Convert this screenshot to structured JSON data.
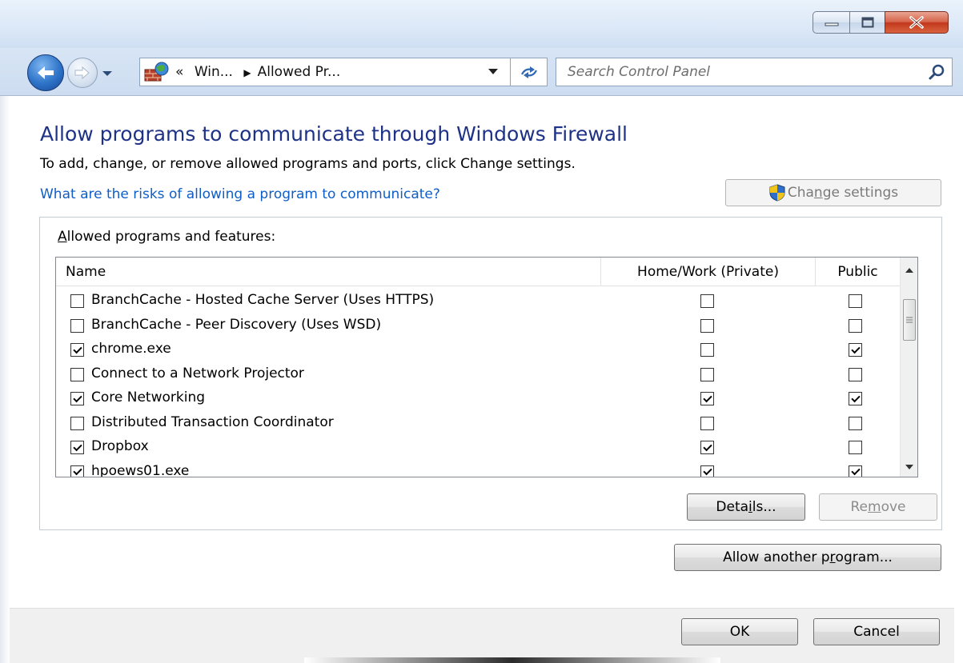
{
  "window": {
    "controls": [
      "minimize-icon",
      "maximize-icon",
      "close-icon"
    ]
  },
  "nav": {
    "address_crumb_1": "Win...",
    "address_crumb_2": "Allowed Pr...",
    "address_prefix": "«",
    "search_placeholder": "Search Control Panel"
  },
  "page": {
    "title": "Allow programs to communicate through Windows Firewall",
    "subtitle": "To add, change, or remove allowed programs and ports, click Change settings.",
    "risk_link": "What are the risks of allowing a program to communicate?",
    "change_settings": {
      "pre": "Cha",
      "mnemonic": "n",
      "post": "ge settings"
    }
  },
  "group": {
    "label_mnemonic": "A",
    "label_rest": "llowed programs and features:",
    "columns": {
      "name": "Name",
      "home": "Home/Work (Private)",
      "public": "Public"
    },
    "rows": [
      {
        "name": "BranchCache - Hosted Cache Server (Uses HTTPS)",
        "enabled": false,
        "home": false,
        "public": false
      },
      {
        "name": "BranchCache - Peer Discovery (Uses WSD)",
        "enabled": false,
        "home": false,
        "public": false
      },
      {
        "name": "chrome.exe",
        "enabled": true,
        "home": false,
        "public": true
      },
      {
        "name": "Connect to a Network Projector",
        "enabled": false,
        "home": false,
        "public": false
      },
      {
        "name": "Core Networking",
        "enabled": true,
        "home": true,
        "public": true
      },
      {
        "name": "Distributed Transaction Coordinator",
        "enabled": false,
        "home": false,
        "public": false
      },
      {
        "name": "Dropbox",
        "enabled": true,
        "home": true,
        "public": false
      },
      {
        "name": "hpoews01.exe",
        "enabled": true,
        "home": true,
        "public": true
      }
    ],
    "details_button": {
      "pre": "Deta",
      "mnemonic": "i",
      "post": "ls..."
    },
    "remove_button": {
      "pre": "Re",
      "mnemonic": "m",
      "post": "ove"
    }
  },
  "allow_another": {
    "pre": "Allow another p",
    "mnemonic": "r",
    "post": "ogram..."
  },
  "footer": {
    "ok": "OK",
    "cancel": "Cancel"
  },
  "colors": {
    "heading": "#1e3287",
    "link": "#0f5ec7",
    "disabled_text": "#8c8c8c"
  }
}
